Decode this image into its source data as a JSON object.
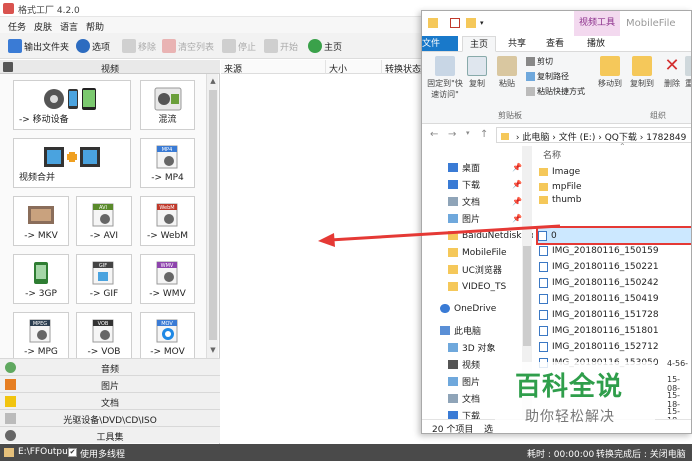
{
  "ff": {
    "title": "格式工厂 4.2.0",
    "menu": [
      "任务",
      "皮肤",
      "语言",
      "帮助"
    ],
    "toolbar": {
      "output_folder": "输出文件夹",
      "options": "选项",
      "remove": "移除",
      "clear_list": "清空列表",
      "stop": "停止",
      "start": "开始",
      "home": "主页"
    },
    "video_header": "视频",
    "tiles": [
      {
        "label": "-> 移动设备"
      },
      {
        "label": "混流"
      },
      {
        "label": "视频合并"
      },
      {
        "label": "-> MP4"
      },
      {
        "label": "-> MKV"
      },
      {
        "label": "-> AVI"
      },
      {
        "label": "-> WebM"
      },
      {
        "label": "-> 3GP"
      },
      {
        "label": "-> GIF"
      },
      {
        "label": "-> WMV"
      },
      {
        "label": "-> MPG"
      },
      {
        "label": "-> VOB"
      },
      {
        "label": "-> MOV"
      }
    ],
    "tile_badges": [
      "MP4",
      "AVI",
      "WebM",
      "GIF",
      "WMV",
      "MPEG",
      "VOB",
      "MOV"
    ],
    "categories": [
      "音频",
      "图片",
      "文档",
      "光驱设备\\DVD\\CD\\ISO",
      "工具集"
    ],
    "columns": [
      "来源",
      "大小",
      "转换状态"
    ],
    "status": {
      "path": "E:\\FFOutput",
      "check": "✔",
      "multithread": "使用多线程",
      "time": "耗时 : 00:00:00",
      "after": "转换完成后 : 关闭电脑"
    }
  },
  "explorer": {
    "ctx_tab": "视频工具",
    "window_name": "MobileFile",
    "tabs": [
      "文件",
      "主页",
      "共享",
      "查看",
      "播放"
    ],
    "ribbon": {
      "pin_quick": "固定到\"快速访问\"",
      "copy": "复制",
      "paste": "粘贴",
      "cut": "剪切",
      "copy_path": "复制路径",
      "paste_shortcut": "粘贴快捷方式",
      "clipboard_group": "剪贴板",
      "move_to": "移动到",
      "copy_to": "复制到",
      "delete": "删除",
      "rename": "重",
      "organize_group": "组织"
    },
    "address": [
      "此电脑",
      "文件 (E:)",
      "QQ下载",
      "1782849"
    ],
    "nav": [
      {
        "label": "桌面",
        "pin": true
      },
      {
        "label": "下载",
        "pin": true
      },
      {
        "label": "文档",
        "pin": true
      },
      {
        "label": "图片",
        "pin": true
      },
      {
        "label": "BaiduNetdiskDo",
        "pin": false
      },
      {
        "label": "MobileFile",
        "pin": false
      },
      {
        "label": "UC浏览器",
        "pin": false
      },
      {
        "label": "VIDEO_TS",
        "pin": false
      },
      {
        "label": "OneDrive",
        "pin": false
      },
      {
        "label": "此电脑",
        "pin": false
      },
      {
        "label": "3D 对象",
        "pin": false
      },
      {
        "label": "视频",
        "pin": false
      },
      {
        "label": "图片",
        "pin": false
      },
      {
        "label": "文档",
        "pin": false
      },
      {
        "label": "下载",
        "pin": false
      }
    ],
    "files_header": "名称",
    "files": [
      {
        "name": "Image",
        "type": "folder"
      },
      {
        "name": "mpFile",
        "type": "folder"
      },
      {
        "name": "thumb",
        "type": "folder"
      },
      {
        "name": "0",
        "type": "file",
        "selected": true
      },
      {
        "name": "IMG_20180116_150159",
        "type": "file"
      },
      {
        "name": "IMG_20180116_150221",
        "type": "file"
      },
      {
        "name": "IMG_20180116_150242",
        "type": "file"
      },
      {
        "name": "IMG_20180116_150419",
        "type": "file"
      },
      {
        "name": "IMG_20180116_151728",
        "type": "file"
      },
      {
        "name": "IMG_20180116_151801",
        "type": "file"
      },
      {
        "name": "IMG_20180116_152712",
        "type": "file"
      },
      {
        "name": "IMG_20180116_153050",
        "type": "file"
      }
    ],
    "dates": [
      "4-56-",
      "15-08-",
      "15-18-",
      "15-18-"
    ],
    "status_count": "20 个项目",
    "status_sel": "选"
  },
  "watermark": {
    "title": "百科全说",
    "subtitle": "助你轻松解决"
  },
  "colors": {
    "arrow": "#e53935",
    "file_tab": "#1979ca",
    "ctx_tab_bg": "#f3d9ef",
    "watermark": "#2f9e4b"
  }
}
